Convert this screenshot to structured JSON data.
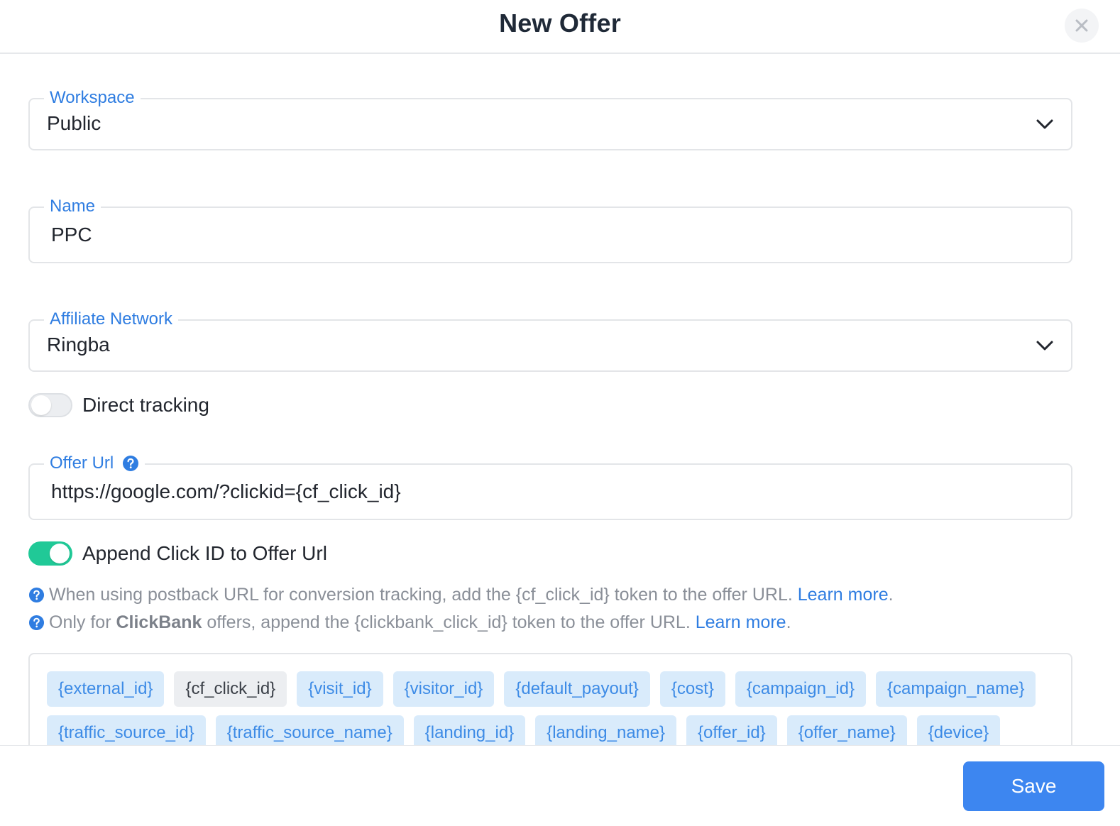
{
  "header": {
    "title": "New Offer"
  },
  "colors": {
    "accent": "#2f7de1",
    "toggle_on": "#20c997",
    "save_button": "#3d86f0",
    "token_bg": "#d9ebfb"
  },
  "workspace": {
    "label": "Workspace",
    "value": "Public"
  },
  "name": {
    "label": "Name",
    "value": "PPC"
  },
  "affiliate_network": {
    "label": "Affiliate Network",
    "value": "Ringba"
  },
  "direct_tracking": {
    "label": "Direct tracking",
    "enabled": false
  },
  "offer_url": {
    "label": "Offer Url",
    "value": "https://google.com/?clickid={cf_click_id}"
  },
  "append_click_id": {
    "label": "Append Click ID to Offer Url",
    "enabled": true
  },
  "hints": {
    "postback": {
      "text": "When using postback URL for conversion tracking, add the {cf_click_id} token to the offer URL.",
      "link": "Learn more",
      "end": "."
    },
    "clickbank": {
      "prefix": "Only for",
      "bold": "ClickBank",
      "text": "offers, append the {clickbank_click_id} token to the offer URL.",
      "link": "Learn more",
      "end": "."
    }
  },
  "tokens": [
    "{external_id}",
    "{cf_click_id}",
    "{visit_id}",
    "{visitor_id}",
    "{default_payout}",
    "{cost}",
    "{campaign_id}",
    "{campaign_name}",
    "{traffic_source_id}",
    "{traffic_source_name}",
    "{landing_id}",
    "{landing_name}",
    "{offer_id}",
    "{offer_name}",
    "{device}"
  ],
  "active_token": "{cf_click_id}",
  "footer": {
    "save_label": "Save"
  }
}
